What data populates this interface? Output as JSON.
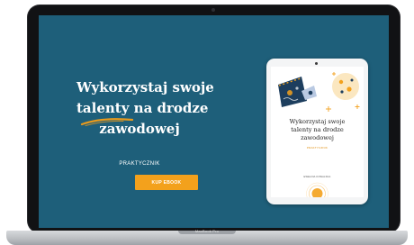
{
  "hero": {
    "title_line1": "Wykorzystaj swoje",
    "title_line2_part1": "talenty",
    "title_line2_part2": " na drodze",
    "title_line3": "zawodowej",
    "subtitle": "PRAKTYCZNIK",
    "cta_label": "KUP EBOOK"
  },
  "ebook": {
    "title_line1": "Wykorzystaj swoje",
    "title_line2": "talenty na drodze",
    "title_line3": "zawodowej",
    "label": "PRAKTYCZNIK",
    "author": "EWELINA KOWALSKA"
  },
  "device": {
    "label": "MacBook Pro"
  },
  "colors": {
    "screen_bg": "#1e5f7a",
    "accent": "#f3a11c",
    "swash": "#e79a1d",
    "text_light": "#ffffff"
  }
}
